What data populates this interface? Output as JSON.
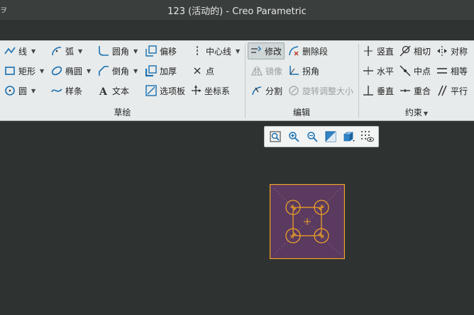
{
  "window": {
    "title": "123 (活动的) - Creo Parametric",
    "corner_glyph": "ヲ"
  },
  "ribbon": {
    "sketch_group": {
      "title": "草绘",
      "items": {
        "line": "线",
        "arc": "弧",
        "fillet": "圆角",
        "offset": "偏移",
        "centerline": "中心线",
        "rectangle": "矩形",
        "ellipse": "椭圆",
        "chamfer": "倒角",
        "thicken": "加厚",
        "point": "点",
        "circle": "圆",
        "spline": "样条",
        "text": "文本",
        "palette": "选项板",
        "coordsys": "坐标系"
      }
    },
    "edit_group": {
      "title": "编辑",
      "items": {
        "modify": "修改",
        "delete_segment": "删除段",
        "mirror": "镜像",
        "corner": "拐角",
        "divide": "分割",
        "rotate_resize": "旋转调整大小"
      }
    },
    "constraint_group": {
      "title": "约束",
      "items": {
        "vertical": "竖直",
        "tangent": "相切",
        "symmetric": "对称",
        "horizontal": "水平",
        "midpoint": "中点",
        "equal": "相等",
        "perpendicular": "垂直",
        "coincident": "重合",
        "parallel": "平行"
      }
    }
  },
  "colors": {
    "sketch_fill": "#5a3a5e",
    "sketch_stroke": "#f5a623",
    "background": "#2e3332",
    "ribbon_bg": "#e7ebeb"
  }
}
